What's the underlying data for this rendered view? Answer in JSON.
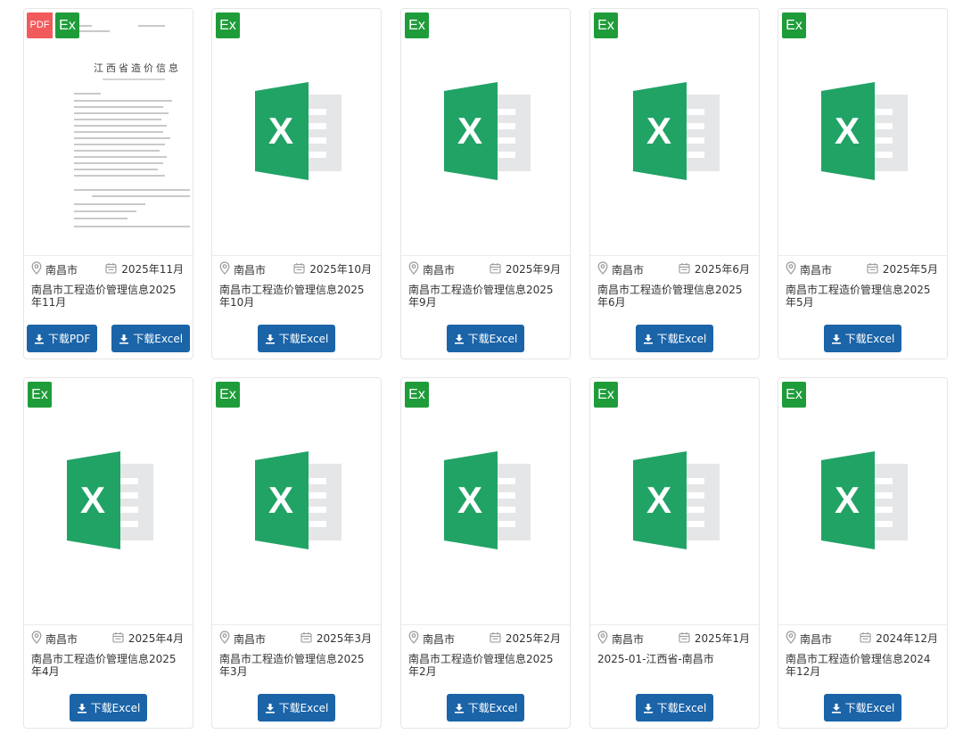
{
  "colors": {
    "button": "#1b64a8",
    "excel_green": "#21a366",
    "ex_badge": "#1f9c3a",
    "pdf_badge": "#f25b5b"
  },
  "badges": {
    "excel": "Ex",
    "pdf": "PDF"
  },
  "pdf_preview": {
    "title": "江西省造价信息"
  },
  "cards": [
    {
      "location": "南昌市",
      "date": "2025年11月",
      "title": "南昌市工程造价管理信息2025年11月",
      "buttons": [
        "下载PDF",
        "下载Excel"
      ],
      "has_pdf": true
    },
    {
      "location": "南昌市",
      "date": "2025年10月",
      "title": "南昌市工程造价管理信息2025年10月",
      "buttons": [
        "下载Excel"
      ]
    },
    {
      "location": "南昌市",
      "date": "2025年9月",
      "title": "南昌市工程造价管理信息2025年9月",
      "buttons": [
        "下载Excel"
      ]
    },
    {
      "location": "南昌市",
      "date": "2025年6月",
      "title": "南昌市工程造价管理信息2025年6月",
      "buttons": [
        "下载Excel"
      ]
    },
    {
      "location": "南昌市",
      "date": "2025年5月",
      "title": "南昌市工程造价管理信息2025年5月",
      "buttons": [
        "下载Excel"
      ]
    },
    {
      "location": "南昌市",
      "date": "2025年4月",
      "title": "南昌市工程造价管理信息2025年4月",
      "buttons": [
        "下载Excel"
      ]
    },
    {
      "location": "南昌市",
      "date": "2025年3月",
      "title": "南昌市工程造价管理信息2025年3月",
      "buttons": [
        "下载Excel"
      ]
    },
    {
      "location": "南昌市",
      "date": "2025年2月",
      "title": "南昌市工程造价管理信息2025年2月",
      "buttons": [
        "下载Excel"
      ]
    },
    {
      "location": "南昌市",
      "date": "2025年1月",
      "title": "2025-01-江西省-南昌市",
      "buttons": [
        "下载Excel"
      ]
    },
    {
      "location": "南昌市",
      "date": "2024年12月",
      "title": "南昌市工程造价管理信息2024年12月",
      "buttons": [
        "下载Excel"
      ]
    }
  ]
}
